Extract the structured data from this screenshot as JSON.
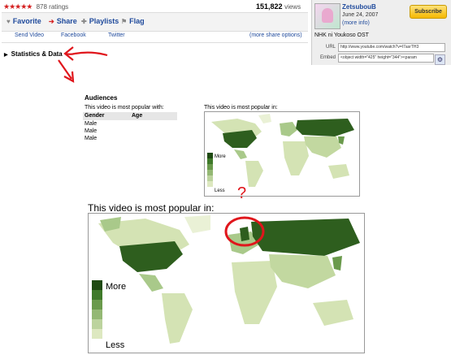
{
  "video": {
    "stars": "★★★★★",
    "ratings": "878 ratings",
    "views_count": "151,822",
    "views_label": "views",
    "actions": [
      {
        "icon": "♥",
        "label": "Favorite"
      },
      {
        "icon": "➔",
        "label": "Share"
      },
      {
        "icon": "✚",
        "label": "Playlists"
      },
      {
        "icon": "⚑",
        "label": "Flag"
      }
    ],
    "share": {
      "send_video": "Send Video",
      "facebook": "Facebook",
      "twitter": "Twitter",
      "more": "(more share options)"
    }
  },
  "channel": {
    "name": "ZetsubouB",
    "date": "June 24, 2007",
    "more_info": "(more info)",
    "subscribe": "Subscribe",
    "video_title": "NHK ni Youkoso OST",
    "url_label": "URL",
    "url_value": "http://www.youtube.com/watch?v=I7asrTH3",
    "embed_label": "Embed",
    "embed_value": "<object width=\"425\" height=\"344\"><param"
  },
  "stats": {
    "toggle_label": "Statistics & Data",
    "audiences": {
      "title": "Audiences",
      "subtitle": "This video is most popular with:",
      "columns": [
        "Gender",
        "Age"
      ],
      "rows": [
        [
          "Male",
          ""
        ],
        [
          "Male",
          ""
        ],
        [
          "Male",
          ""
        ]
      ]
    },
    "map_small": {
      "caption": "This video is most popular in:",
      "legend_more": "More",
      "legend_less": "Less"
    },
    "map_large": {
      "caption": "This video is most popular in:",
      "legend_more": "More",
      "legend_less": "Less"
    }
  },
  "annotation": {
    "question": "?"
  },
  "colors": {
    "link": "#1f4a9c",
    "annotation_red": "#e0161c",
    "map_dark": "#2e5e1e",
    "map_mid": "#6a9a4c",
    "map_light": "#dde8c0"
  }
}
